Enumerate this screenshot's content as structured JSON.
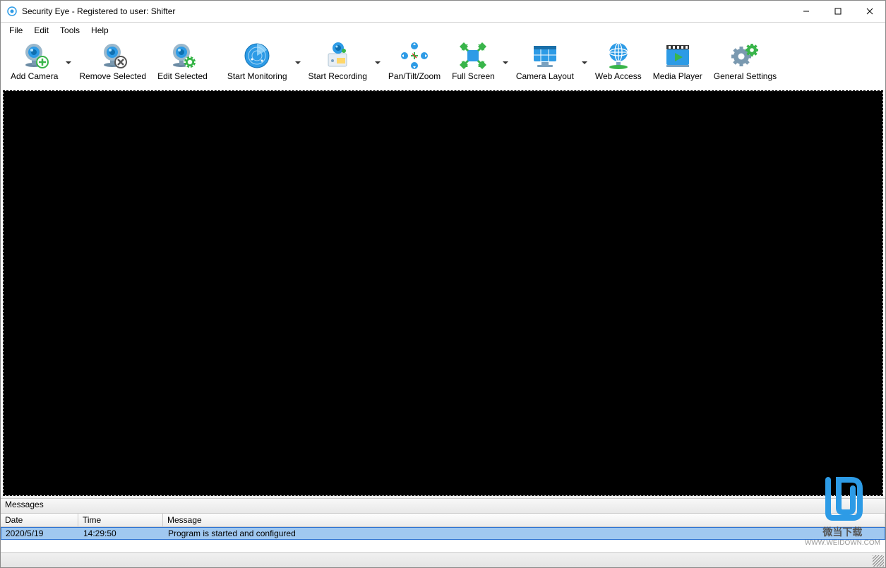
{
  "window": {
    "title": "Security Eye - Registered to user: Shifter"
  },
  "menubar": [
    "File",
    "Edit",
    "Tools",
    "Help"
  ],
  "toolbar": [
    {
      "id": "add-camera",
      "label": "Add Camera",
      "has_dropdown": true
    },
    {
      "id": "remove-selected",
      "label": "Remove Selected",
      "has_dropdown": false
    },
    {
      "id": "edit-selected",
      "label": "Edit Selected",
      "has_dropdown": false
    },
    {
      "id": "start-monitoring",
      "label": "Start Monitoring",
      "has_dropdown": true
    },
    {
      "id": "start-recording",
      "label": "Start Recording",
      "has_dropdown": true
    },
    {
      "id": "pan-tilt-zoom",
      "label": "Pan/Tilt/Zoom",
      "has_dropdown": false
    },
    {
      "id": "full-screen",
      "label": "Full Screen",
      "has_dropdown": true
    },
    {
      "id": "camera-layout",
      "label": "Camera Layout",
      "has_dropdown": true
    },
    {
      "id": "web-access",
      "label": "Web Access",
      "has_dropdown": false
    },
    {
      "id": "media-player",
      "label": "Media Player",
      "has_dropdown": false
    },
    {
      "id": "general-settings",
      "label": "General Settings",
      "has_dropdown": false
    }
  ],
  "messages": {
    "panel_label": "Messages",
    "columns": [
      "Date",
      "Time",
      "Message"
    ],
    "rows": [
      {
        "date": "2020/5/19",
        "time": "14:29:50",
        "message": "Program is started and configured"
      }
    ]
  },
  "watermark": {
    "line1": "微当下载",
    "line2": "WWW.WEIDOWN.COM"
  },
  "colors": {
    "accent_blue": "#2d9be6",
    "accent_green": "#39b54a"
  }
}
